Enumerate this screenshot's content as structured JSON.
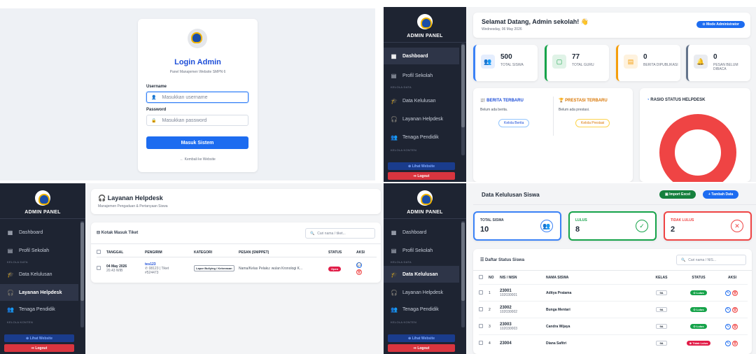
{
  "login": {
    "title": "Login Admin",
    "subtitle": "Panel Manajemen Website SMPN 6",
    "username_label": "Username",
    "username_placeholder": "Masukkan username",
    "password_label": "Password",
    "password_placeholder": "Masukkan password",
    "submit": "Masuk Sistem",
    "back_link": "← Kembali ke Website"
  },
  "sidebar": {
    "title": "ADMIN PANEL",
    "items": {
      "dashboard": "Dashboard",
      "profil": "Profil Sekolah",
      "section_data": "KELOLA DATA",
      "kelulusan": "Data Kelulusan",
      "helpdesk": "Layanan Helpdesk",
      "pendidik": "Tenaga Pendidik",
      "section_konten": "KELOLA KONTEN"
    },
    "lihat_website": "⊕ Lihat Website",
    "logout": "⇨ Logout"
  },
  "dashboard": {
    "greeting": "Selamat Datang, Admin sekolah! 👋",
    "date": "Wednesday, 06 May 2026",
    "mode_badge": "⊙ Mode Administrator",
    "stats": [
      {
        "value": "500",
        "label": "TOTAL SISWA",
        "color": "#3b82f6"
      },
      {
        "value": "77",
        "label": "TOTAL GURU",
        "color": "#16a34a"
      },
      {
        "value": "0",
        "label": "BERITA DIPUBLIKASI",
        "color": "#f59e0b"
      },
      {
        "value": "0",
        "label": "PESAN BELUM DIBACA",
        "color": "#64748b"
      }
    ],
    "berita_title": "BERITA TERBARU",
    "berita_empty": "Belum ada berita.",
    "berita_btn": "Kelola Berita",
    "prestasi_title": "PRESTASI TERBARU",
    "prestasi_empty": "Belum ada prestasi.",
    "prestasi_btn": "Kelola Prestasi",
    "rasio_title": "RASIO STATUS HELPDESK"
  },
  "helpdesk": {
    "title": "Layanan Helpdesk",
    "subtitle": "Manajemen Pengaduan & Pertanyaan Siswa",
    "inbox": "Kotak Masuk Tiket",
    "search_placeholder": "Cari nama / tiket...",
    "columns": [
      "TANGGAL",
      "PENGIRIM",
      "KATEGORI",
      "PESAN (SNIPPET)",
      "STATUS",
      "AKSI"
    ],
    "row": {
      "date": "04 May 2026",
      "time": "20.43 WIB",
      "sender": "tes123",
      "phone": "✆ 08123 | Tiket",
      "ticket": "#524473",
      "category": "Lapor Bullying / Kekerasan",
      "message": "Nama/Kelas Pelaku: wulan Kronologi K...",
      "status": "Open"
    }
  },
  "kelulusan": {
    "title": "Data Kelulusan Siswa",
    "import_btn": "▣ Import Excel",
    "add_btn": "+ Tambah Data",
    "stats": [
      {
        "label": "TOTAL SISWA",
        "value": "10",
        "color": "#3b82f6",
        "icon": "users-icon"
      },
      {
        "label": "LULUS",
        "value": "8",
        "color": "#16a34a",
        "icon": "check-icon"
      },
      {
        "label": "TIDAK LULUS",
        "value": "2",
        "color": "#ef4444",
        "icon": "x-icon"
      }
    ],
    "list_title": "Daftar Status Siswa",
    "search_placeholder": "Cari nama / NIS...",
    "columns": [
      "NO",
      "NIS / NISN",
      "NAMA SISWA",
      "KELAS",
      "STATUS",
      "AKSI"
    ],
    "rows": [
      {
        "no": "1",
        "nis": "23001",
        "nisn": "102030001",
        "name": "Aditya Pratama",
        "kelas": "9A",
        "status": "⊙ Lulus"
      },
      {
        "no": "2",
        "nis": "23002",
        "nisn": "102030002",
        "name": "Bunga Mentari",
        "kelas": "9A",
        "status": "⊙ Lulus"
      },
      {
        "no": "3",
        "nis": "23003",
        "nisn": "102030003",
        "name": "Candra Wijaya",
        "kelas": "9A",
        "status": "⊙ Lulus"
      },
      {
        "no": "4",
        "nis": "23004",
        "nisn": "",
        "name": "Diana Safitri",
        "kelas": "9A",
        "status": "⊗ Tidak Lulus"
      }
    ]
  }
}
